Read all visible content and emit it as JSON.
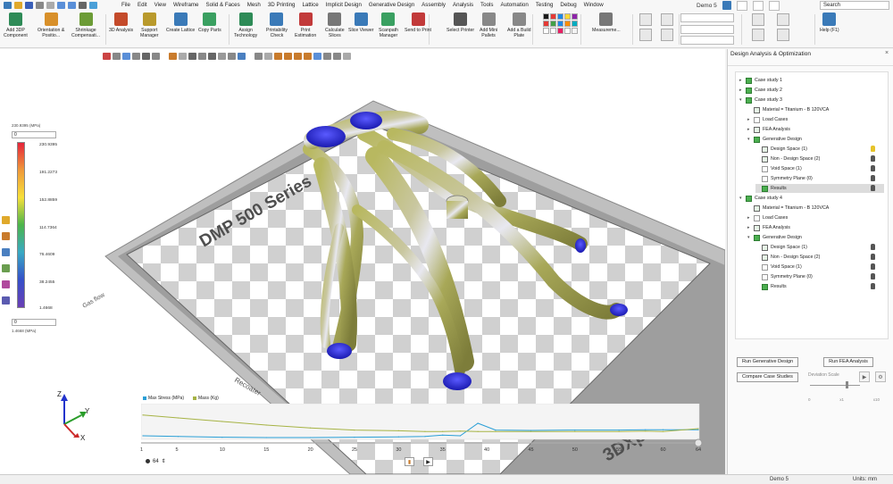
{
  "app": {
    "doc_title": "Demo 5"
  },
  "menu": [
    "File",
    "Edit",
    "View",
    "Wireframe",
    "Solid & Faces",
    "Mesh",
    "3D Printing",
    "Lattice",
    "Implicit Design",
    "Generative Design",
    "Assembly",
    "Analysis",
    "Tools",
    "Automation",
    "Testing",
    "Debug",
    "Window"
  ],
  "search": {
    "label": "Search"
  },
  "ribbon": [
    {
      "label": "Add 3DP\nComponent",
      "icon": "add-component-icon",
      "color": "#2e8b57"
    },
    {
      "label": "Orientation &\nPositio...",
      "icon": "orientation-icon",
      "color": "#d8902a"
    },
    {
      "label": "Shrinkage\nCompensati...",
      "icon": "shrinkage-icon",
      "color": "#6c9c36"
    },
    {
      "label": "3D Analysis",
      "icon": "analysis-icon",
      "color": "#c44a2a"
    },
    {
      "label": "Support\nManager",
      "icon": "support-icon",
      "color": "#b99a2c"
    },
    {
      "label": "Create Lattice",
      "icon": "lattice-icon",
      "color": "#3a7ab8"
    },
    {
      "label": "Copy Parts",
      "icon": "copy-icon",
      "color": "#3aa061"
    },
    {
      "label": "Assign\nTechnology",
      "icon": "technology-icon",
      "color": "#2e8b57"
    },
    {
      "label": "Printability\nCheck",
      "icon": "printability-icon",
      "color": "#3a7ab8"
    },
    {
      "label": "Print\nEstimation",
      "icon": "estimation-icon",
      "color": "#c23a3a"
    },
    {
      "label": "Calculate\nSlices",
      "icon": "slices-icon",
      "color": "#777"
    },
    {
      "label": "Slice Viewer",
      "icon": "viewer-icon",
      "color": "#3a7ab8"
    },
    {
      "label": "Scanpath\nManager",
      "icon": "scanpath-icon",
      "color": "#3aa061"
    },
    {
      "label": "Send to Print",
      "icon": "print-icon",
      "color": "#c23a3a"
    },
    {
      "label": "Select Printer",
      "icon": "printer-icon",
      "color": "#555"
    },
    {
      "label": "Add Mini\nPallets",
      "icon": "pallets-icon",
      "color": "#888"
    },
    {
      "label": "Add a Build\nPlate",
      "icon": "buildplate-icon",
      "color": "#888"
    },
    {
      "label": "Measureme...",
      "icon": "measure-icon",
      "color": "#777"
    },
    {
      "label": "Help (F1)",
      "icon": "help-icon",
      "color": "#3a7ab8"
    }
  ],
  "palette": [
    "#1a1a1a",
    "#e53935",
    "#1e88e5",
    "#fdd835",
    "#8e24aa",
    "#e53935",
    "#43a047",
    "#1e88e5",
    "#fb8c00",
    "#00acc1",
    "#ffffff",
    "#ffffff",
    "#e91e63",
    "#ffffff",
    "#f4f4f4"
  ],
  "legend": {
    "unit_top": "230.9395 (MPa)",
    "max_input": "0",
    "ticks": [
      "230.9395",
      "191.2273",
      "152.8859",
      "114.7364",
      "76.4609",
      "38.2455",
      "1.4668"
    ],
    "min_input": "0",
    "unit_bottom": "1.4668 (MPa)"
  },
  "scene": {
    "plate_label": "DMP 500 Series",
    "brand": "3DXpert",
    "gas_flow": "Gas flow",
    "recoater": "Recoater"
  },
  "axes": {
    "z": "Z",
    "y": "Y",
    "x": "X"
  },
  "chart": {
    "legend": [
      {
        "name": "Max Stress (MPa)",
        "color": "#2a9fd6"
      },
      {
        "name": "Mass (Kg)",
        "color": "#a6b344"
      }
    ],
    "x_ticks": [
      "1",
      "5",
      "10",
      "15",
      "20",
      "25",
      "30",
      "35",
      "40",
      "45",
      "50",
      "55",
      "60",
      "64"
    ],
    "layer_value": "64"
  },
  "chart_data": {
    "type": "line",
    "x": [
      1,
      5,
      10,
      15,
      20,
      25,
      30,
      33,
      35,
      37,
      39,
      41,
      45,
      50,
      55,
      58,
      60,
      64
    ],
    "xlim": [
      1,
      64
    ],
    "series": [
      {
        "name": "Max Stress (MPa)",
        "values": [
          10,
          8,
          6,
          5,
          5,
          6,
          7,
          8,
          12,
          10,
          45,
          26,
          25,
          26,
          26,
          27,
          27,
          27
        ]
      },
      {
        "name": "Mass (Kg)",
        "values": [
          68,
          60,
          50,
          40,
          32,
          26,
          24,
          22,
          22,
          23,
          22,
          22,
          22,
          22,
          22,
          23,
          22,
          30
        ]
      }
    ],
    "ylim": [
      0,
      100
    ],
    "title": "",
    "xlabel": "",
    "ylabel": ""
  },
  "panel": {
    "title": "Design Analysis & Optimization",
    "close": "×",
    "tree": [
      {
        "label": "Case study 1",
        "depth": 0,
        "twist": "▸",
        "icon": "case-study-icon",
        "style": "g"
      },
      {
        "label": "Case study 2",
        "depth": 0,
        "twist": "▸",
        "icon": "case-study-icon",
        "style": "g"
      },
      {
        "label": "Case study 3",
        "depth": 0,
        "twist": "▾",
        "icon": "case-study-icon",
        "style": "g"
      },
      {
        "label": "Material = Titanium - B 120VCA",
        "depth": 1,
        "twist": "",
        "icon": "material-icon",
        "style": ""
      },
      {
        "label": "Load Cases",
        "depth": 1,
        "twist": "▸",
        "icon": "load-cases-icon",
        "style": "f"
      },
      {
        "label": "FEA Analysis",
        "depth": 1,
        "twist": "▸",
        "icon": "fea-icon",
        "style": ""
      },
      {
        "label": "Generative Design",
        "depth": 1,
        "twist": "▾",
        "icon": "generative-icon",
        "style": "g"
      },
      {
        "label": "Design Space (1)",
        "depth": 2,
        "twist": "",
        "icon": "design-space-icon",
        "style": ""
      },
      {
        "label": "Non - Design Space (2)",
        "depth": 2,
        "twist": "",
        "icon": "non-design-space-icon",
        "style": ""
      },
      {
        "label": "Void Space (1)",
        "depth": 2,
        "twist": "",
        "icon": "void-space-icon",
        "style": "f"
      },
      {
        "label": "Symmetry Plane (0)",
        "depth": 2,
        "twist": "",
        "icon": "symmetry-plane-icon",
        "style": "f"
      },
      {
        "label": "Results",
        "depth": 2,
        "twist": "",
        "icon": "results-icon",
        "style": "g",
        "selected": true
      },
      {
        "label": "Case study 4",
        "depth": 0,
        "twist": "▾",
        "icon": "case-study-icon",
        "style": "g"
      },
      {
        "label": "Material = Titanium - B 120VCA",
        "depth": 1,
        "twist": "",
        "icon": "material-icon",
        "style": ""
      },
      {
        "label": "Load Cases",
        "depth": 1,
        "twist": "▸",
        "icon": "load-cases-icon",
        "style": "f"
      },
      {
        "label": "FEA Analysis",
        "depth": 1,
        "twist": "▸",
        "icon": "fea-icon",
        "style": ""
      },
      {
        "label": "Generative Design",
        "depth": 1,
        "twist": "▾",
        "icon": "generative-icon",
        "style": "g"
      },
      {
        "label": "Design Space (1)",
        "depth": 2,
        "twist": "",
        "icon": "design-space-icon",
        "style": ""
      },
      {
        "label": "Non - Design Space (2)",
        "depth": 2,
        "twist": "",
        "icon": "non-design-space-icon",
        "style": ""
      },
      {
        "label": "Void Space (1)",
        "depth": 2,
        "twist": "",
        "icon": "void-space-icon",
        "style": "f"
      },
      {
        "label": "Symmetry Plane (0)",
        "depth": 2,
        "twist": "",
        "icon": "symmetry-plane-icon",
        "style": "f"
      },
      {
        "label": "Results",
        "depth": 2,
        "twist": "",
        "icon": "results-icon",
        "style": "g"
      }
    ],
    "run_generative": "Run Generative Design",
    "run_fea": "Run FEA Analysis",
    "compare": "Compare Case Studies",
    "deviation_scale": "Deviation Scale",
    "dev_values": [
      "0",
      "x1",
      "x10"
    ]
  },
  "status": {
    "doc": "Demo 5",
    "units": "Units: mm"
  }
}
